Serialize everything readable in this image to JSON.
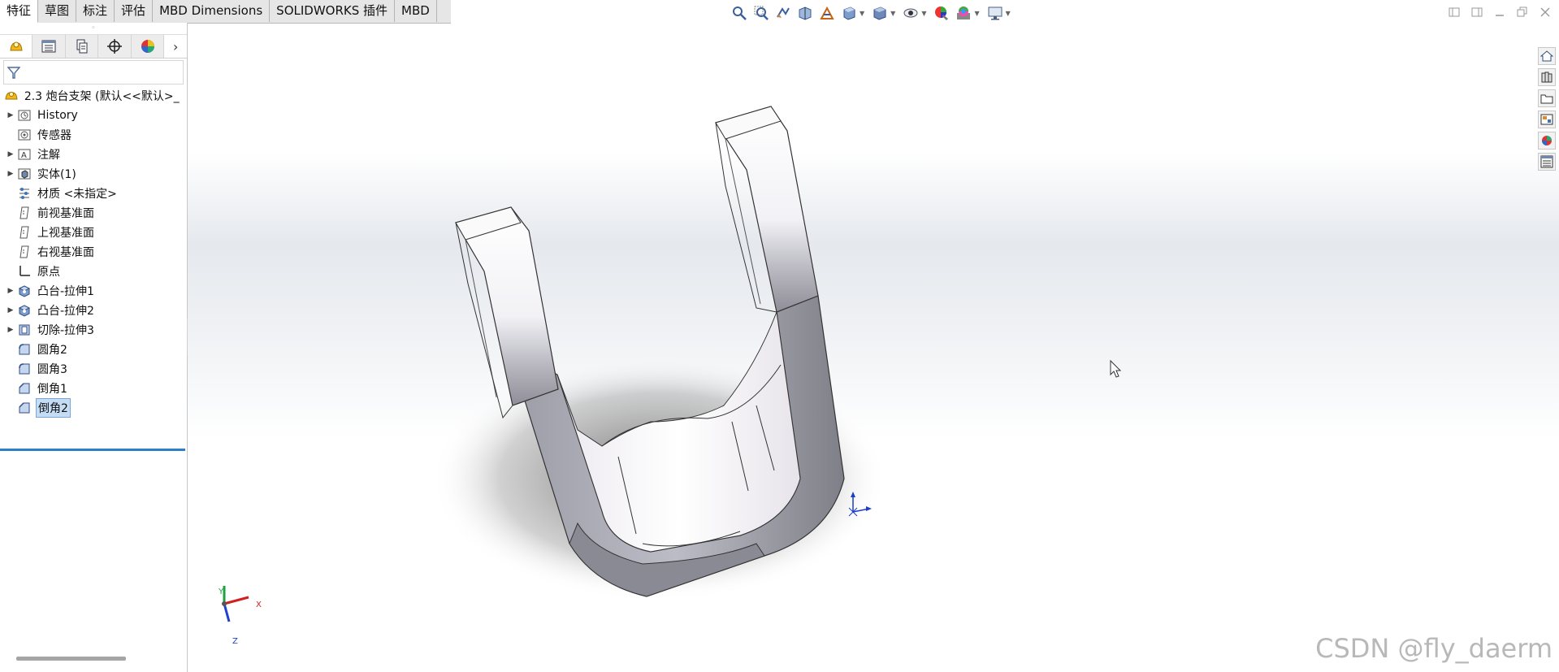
{
  "command_tabs": [
    "特征",
    "草图",
    "标注",
    "评估",
    "MBD Dimensions",
    "SOLIDWORKS 插件",
    "MBD"
  ],
  "active_tab_index": 0,
  "hud_icons": [
    "zoom-to-fit-icon",
    "zoom-area-icon",
    "previous-view-icon",
    "section-view-icon",
    "dynamic-annotation-icon",
    "view-orientation-icon",
    "display-style-icon",
    "hide-show-icon",
    "edit-appearance-icon",
    "apply-scene-icon",
    "view-settings-icon"
  ],
  "panel_tabs": [
    "featuremanager-icon",
    "propertymanager-icon",
    "configurationmanager-icon",
    "dimxpert-icon",
    "displaymanager-icon"
  ],
  "tree": {
    "root": "2.3 炮台支架  (默认<<默认>_",
    "items": [
      {
        "label": "History",
        "icon": "history-icon",
        "expandable": true
      },
      {
        "label": "传感器",
        "icon": "sensor-icon",
        "expandable": false
      },
      {
        "label": "注解",
        "icon": "annotation-icon",
        "expandable": true
      },
      {
        "label": "实体(1)",
        "icon": "solid-bodies-icon",
        "expandable": true
      },
      {
        "label": "材质 <未指定>",
        "icon": "material-icon",
        "expandable": false
      },
      {
        "label": "前视基准面",
        "icon": "plane-icon",
        "expandable": false
      },
      {
        "label": "上视基准面",
        "icon": "plane-icon",
        "expandable": false
      },
      {
        "label": "右视基准面",
        "icon": "plane-icon",
        "expandable": false
      },
      {
        "label": "原点",
        "icon": "origin-icon",
        "expandable": false
      },
      {
        "label": "凸台-拉伸1",
        "icon": "boss-extrude-icon",
        "expandable": true
      },
      {
        "label": "凸台-拉伸2",
        "icon": "boss-extrude-icon",
        "expandable": true
      },
      {
        "label": "切除-拉伸3",
        "icon": "cut-extrude-icon",
        "expandable": true
      },
      {
        "label": "圆角2",
        "icon": "fillet-icon",
        "expandable": false
      },
      {
        "label": "圆角3",
        "icon": "fillet-icon",
        "expandable": false
      },
      {
        "label": "倒角1",
        "icon": "chamfer-icon",
        "expandable": false
      },
      {
        "label": "倒角2",
        "icon": "chamfer-icon",
        "expandable": false,
        "selected": true
      }
    ]
  },
  "triad": {
    "x": "X",
    "y": "Y",
    "z": "Z"
  },
  "taskpane_icons": [
    "home-icon",
    "design-library-icon",
    "file-explorer-icon",
    "view-palette-icon",
    "appearances-icon",
    "custom-properties-icon"
  ],
  "watermark": "CSDN @fly_daerm",
  "colors": {
    "selection": "#c5dcf5",
    "rollback_bar": "#2e7ec9",
    "x_axis": "#d02020",
    "y_axis": "#20a040",
    "z_axis": "#2040d0"
  }
}
